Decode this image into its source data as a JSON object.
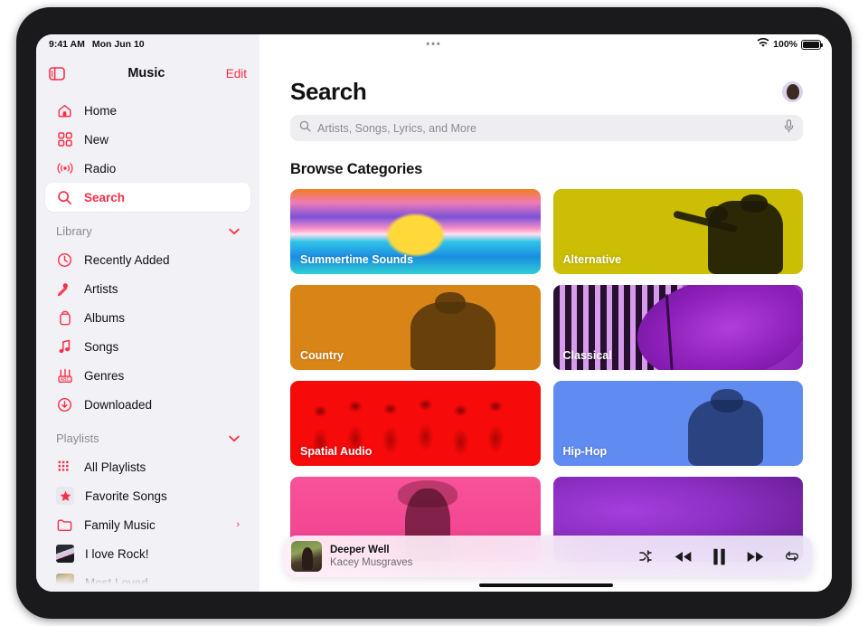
{
  "status_bar": {
    "time": "9:41 AM",
    "date": "Mon Jun 10",
    "multitask_dots": "•••",
    "wifi_icon": "wifi-icon",
    "battery_percent": "100%"
  },
  "sidebar": {
    "toggle_icon": "sidebar-toggle-icon",
    "title": "Music",
    "edit_label": "Edit",
    "primary_items": [
      {
        "label": "Home",
        "icon": "home-icon",
        "selected": false
      },
      {
        "label": "New",
        "icon": "grid-icon",
        "selected": false
      },
      {
        "label": "Radio",
        "icon": "radio-broadcast-icon",
        "selected": false
      },
      {
        "label": "Search",
        "icon": "search-icon",
        "selected": true
      }
    ],
    "library_section": {
      "title": "Library",
      "chevron": "chevron-down-icon",
      "items": [
        {
          "label": "Recently Added",
          "icon": "clock-icon"
        },
        {
          "label": "Artists",
          "icon": "microphone-icon"
        },
        {
          "label": "Albums",
          "icon": "album-icon"
        },
        {
          "label": "Songs",
          "icon": "music-note-icon"
        },
        {
          "label": "Genres",
          "icon": "genres-icon"
        },
        {
          "label": "Downloaded",
          "icon": "download-circle-icon"
        }
      ]
    },
    "playlists_section": {
      "title": "Playlists",
      "chevron": "chevron-down-icon",
      "items": [
        {
          "label": "All Playlists",
          "icon": "playlists-grid-icon",
          "disclosure": ""
        },
        {
          "label": "Favorite Songs",
          "icon": "star-icon",
          "disclosure": ""
        },
        {
          "label": "Family Music",
          "icon": "folder-icon",
          "disclosure": "›"
        },
        {
          "label": "I love Rock!",
          "icon": "playlist-artwork",
          "disclosure": ""
        },
        {
          "label": "Most Loved",
          "icon": "playlist-artwork",
          "disclosure": ""
        }
      ]
    }
  },
  "main": {
    "page_title": "Search",
    "avatar": "user-avatar",
    "search": {
      "icon": "search-icon",
      "placeholder": "Artists, Songs, Lyrics, and More",
      "value": "",
      "mic_icon": "microphone-icon"
    },
    "browse_title": "Browse Categories",
    "categories": [
      {
        "label": "Summertime Sounds",
        "art": "art-summer",
        "accent": "#f37c1f"
      },
      {
        "label": "Alternative",
        "art": "art-alt",
        "accent": "#cbbe04"
      },
      {
        "label": "Country",
        "art": "art-country",
        "accent": "#d98416"
      },
      {
        "label": "Classical",
        "art": "art-classical",
        "accent": "#9c2ec4"
      },
      {
        "label": "Spatial Audio",
        "art": "art-spatial",
        "accent": "#f60a0a"
      },
      {
        "label": "Hip-Hop",
        "art": "art-hiphop",
        "accent": "#608bf0"
      },
      {
        "label": "",
        "art": "art-pink",
        "accent": "#f0418e"
      },
      {
        "label": "",
        "art": "art-purple",
        "accent": "#8a2ec0"
      }
    ]
  },
  "now_playing": {
    "artwork": "album-artwork",
    "title": "Deeper Well",
    "artist": "Kacey Musgraves",
    "controls": [
      {
        "name": "shuffle-button",
        "icon": "shuffle-icon"
      },
      {
        "name": "previous-button",
        "icon": "rewind-icon"
      },
      {
        "name": "pause-button",
        "icon": "pause-icon"
      },
      {
        "name": "next-button",
        "icon": "fast-forward-icon"
      },
      {
        "name": "repeat-button",
        "icon": "repeat-icon"
      }
    ]
  },
  "colors": {
    "accent": "#fa2d48",
    "sidebar_bg": "#f2f1f6",
    "search_field_bg": "#eeedf2",
    "secondary_text": "#8b8b90"
  }
}
